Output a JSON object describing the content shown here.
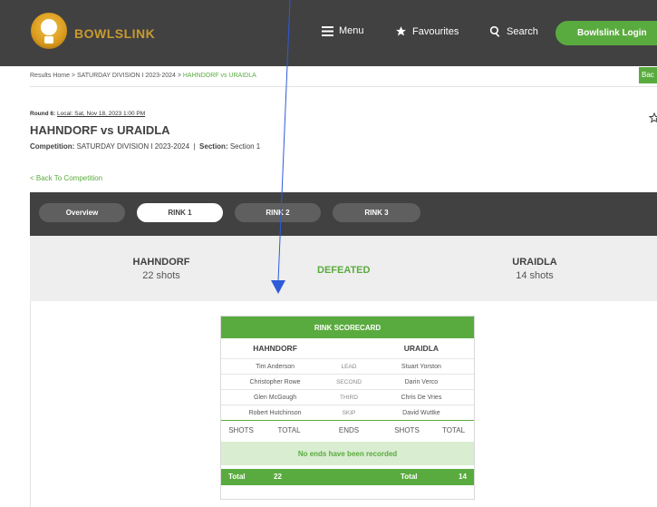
{
  "header": {
    "brand": "BOWLSLINK",
    "menu_label": "Menu",
    "favourites_label": "Favourites",
    "search_label": "Search",
    "login_label": "Bowlslink Login"
  },
  "breadcrumb": {
    "home": "Results Home",
    "sep1": " > ",
    "competition": "SATURDAY DIVISION I 2023-2024",
    "sep2": " > ",
    "current": "HAHNDORF vs URAIDLA",
    "back_tab": "Bac"
  },
  "match": {
    "round_label": "Round 6:",
    "round_date": "Local: Sat, Nov 18, 2023 1:00 PM",
    "title": "HAHNDORF vs URAIDLA",
    "competition_label": "Competition:",
    "competition_value": "SATURDAY DIVISION I 2023-2024",
    "pipe": "|",
    "section_label": "Section:",
    "section_value": "Section 1",
    "back_link": "< Back To Competition"
  },
  "tabs": [
    "Overview",
    "RINK 1",
    "RINK 2",
    "RINK 3"
  ],
  "active_tab": "RINK 1",
  "result": {
    "home_team": "HAHNDORF",
    "home_shots": "22 shots",
    "outcome": "DEFEATED",
    "away_team": "URAIDLA",
    "away_shots": "14 shots"
  },
  "scorecard": {
    "title": "RINK SCORECARD",
    "home_team": "HAHNDORF",
    "away_team": "URAIDLA",
    "players": [
      {
        "home": "Tim Anderson",
        "position": "LEAD",
        "away": "Stuart Yorston"
      },
      {
        "home": "Christopher Rowe",
        "position": "SECOND",
        "away": "Darin Verco"
      },
      {
        "home": "Glen McGough",
        "position": "THIRD",
        "away": "Chris De Vries"
      },
      {
        "home": "Robert Hutchinson",
        "position": "SKIP",
        "away": "David Wuttke"
      }
    ],
    "columns": [
      "SHOTS",
      "TOTAL",
      "ENDS",
      "SHOTS",
      "TOTAL"
    ],
    "empty_message": "No ends have been recorded",
    "home_total_label": "Total",
    "home_total": "22",
    "away_total_label": "Total",
    "away_total": "14"
  },
  "colors": {
    "accent": "#5aab3f",
    "topbar": "#414142",
    "brand_gold": "#c99a2e",
    "pointer": "#2e5bd8"
  },
  "icons": [
    "hamburger-icon",
    "star-icon",
    "search-icon",
    "star-outline-icon",
    "arrow-pointer-icon"
  ]
}
